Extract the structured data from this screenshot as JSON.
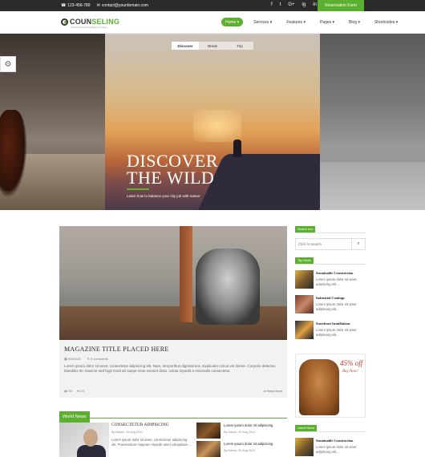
{
  "topbar": {
    "phone": "123-456-789",
    "email": "contact@yourdomain.com",
    "socials": [
      "f",
      "t",
      "G+",
      "ig",
      "in"
    ],
    "reservation_label": "Reservation Form"
  },
  "brand": {
    "name_part1": "COUN",
    "name_part2": "SELING",
    "tagline": "Counseling & Coaching Business Theme"
  },
  "nav": {
    "items": [
      {
        "label": "Home ▾",
        "active": true
      },
      {
        "label": "Services ▾"
      },
      {
        "label": "Features ▾"
      },
      {
        "label": "Pages ▾"
      },
      {
        "label": "Blog ▾"
      },
      {
        "label": "Shortcodes ▾"
      }
    ]
  },
  "hero": {
    "tabs": [
      "Discover",
      "Break",
      "Trip"
    ],
    "title_line1": "DISCOVER",
    "title_line2": "THE WILD",
    "subtitle": "Learn how to balance your city job with nature"
  },
  "feature": {
    "title": "MAGAZINE TITLE PLACED HERE",
    "date": "9/9/2015",
    "comments": "5 comments",
    "excerpt": "Lorem ipsum dolor sit amet, consectetur adipiscing elit. Nam, temporibus dignissimos. Explicabo minus vel dolore. Corporis delectus, blanditiis hic maxime sed fugit modi ad saepe esse eveniet dicta, soluta impedit a reiciendis consectetur.",
    "views": "736",
    "likes": "125",
    "read_more": "▸ Read more"
  },
  "world_news": {
    "heading": "World News",
    "main": {
      "title": "CONSECTETUR ADIPISCING",
      "meta": "By Admin, 25 Aug 2012",
      "text": "Lorem ipsum dolor sit amet, consectetur adipiscing elit. Praesentium magnam impedit amet voluptatum..."
    },
    "small": [
      {
        "title": "Lorem ipsum dolor sit adipiscing",
        "meta": "By Admin, 25 Aug 2012"
      },
      {
        "title": "Lorem ipsum dolor sit adipiscing",
        "meta": "By Admin, 25 Aug 2012"
      }
    ]
  },
  "sidebar": {
    "search_label": "Search box",
    "search_placeholder": "Click to Search",
    "top_news_label": "Top News",
    "top_news": [
      {
        "title": "Sustainable Construction",
        "text": "Lorem ipsum dolor sit amet adipiscing elit..."
      },
      {
        "title": "Industrial Coatings",
        "text": "Lorem ipsum dolor sit amet adipiscing elit..."
      },
      {
        "title": "Storefront Installations",
        "text": "Lorem ipsum dolor sit amet adipiscing elit..."
      }
    ],
    "ad": {
      "percent": "45% off",
      "buy": "Buy Now!"
    },
    "latest_label": "Latest News",
    "latest": [
      {
        "title": "Sustainable Construction",
        "text": "Lorem ipsum dolor sit amet adipiscing elit..."
      }
    ]
  },
  "colors": {
    "accent": "#5cb030",
    "topbar": "#2b2b2b"
  },
  "icons": {
    "settings": "gear-icon",
    "search": "search-icon"
  }
}
